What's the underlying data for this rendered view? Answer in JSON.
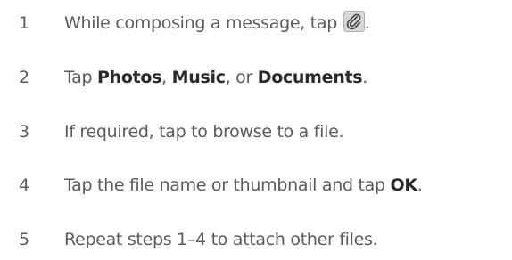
{
  "steps": [
    {
      "number": "1",
      "text_before": "While composing a message, tap",
      "icon": "paperclip-icon",
      "text_after": "."
    },
    {
      "number": "2",
      "text_before": "Tap ",
      "bold_1": "Photos",
      "sep_1": ", ",
      "bold_2": "Music",
      "sep_2": ", or ",
      "bold_3": "Documents",
      "text_after": "."
    },
    {
      "number": "3",
      "text": "If required, tap to browse to a file."
    },
    {
      "number": "4",
      "text_before": "Tap the file name or thumbnail and tap ",
      "bold_1": "OK",
      "text_after": "."
    },
    {
      "number": "5",
      "text": "Repeat steps 1–4 to attach other files."
    }
  ]
}
